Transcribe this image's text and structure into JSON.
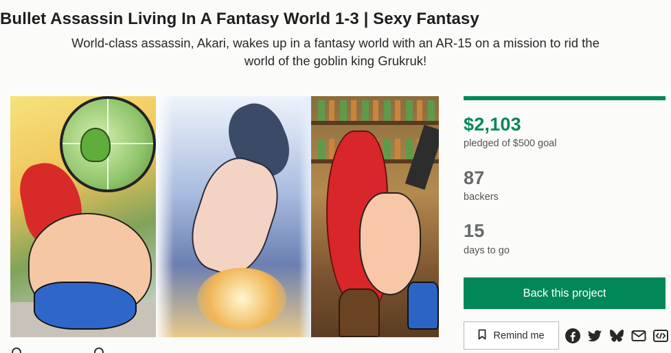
{
  "project": {
    "title": "Bullet Assassin Living In A Fantasy World 1-3 | Sexy Fantasy",
    "blurb": "World-class assassin, Akari, wakes up in a fantasy world with an AR-15 on a mission to rid the world of the goblin king Grukruk!"
  },
  "stats": {
    "funding_progress": 1.0,
    "pledged_amount": "$2,103",
    "pledged_label": "pledged of $500 goal",
    "backers_count": "87",
    "backers_label": "backers",
    "days_count": "15",
    "days_label": "days to go"
  },
  "actions": {
    "back_label": "Back this project",
    "remind_label": "Remind me"
  },
  "share_icons": [
    "facebook-icon",
    "twitter-icon",
    "bluesky-icon",
    "email-icon",
    "embed-icon"
  ],
  "colors": {
    "accent": "#028858",
    "stat_gray": "#656969",
    "background": "#fbfbfa"
  }
}
